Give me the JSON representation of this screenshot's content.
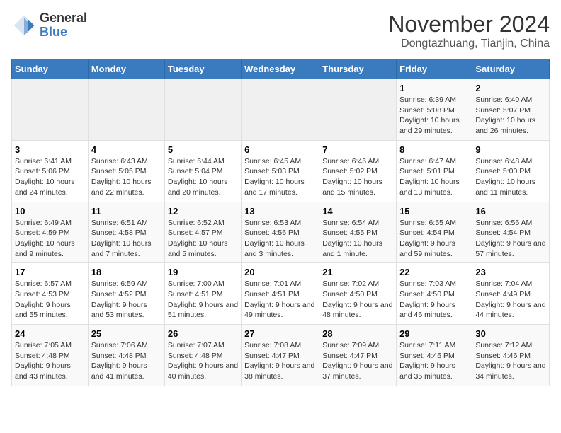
{
  "header": {
    "logo_general": "General",
    "logo_blue": "Blue",
    "month_title": "November 2024",
    "location": "Dongtazhuang, Tianjin, China"
  },
  "days_of_week": [
    "Sunday",
    "Monday",
    "Tuesday",
    "Wednesday",
    "Thursday",
    "Friday",
    "Saturday"
  ],
  "weeks": [
    [
      {
        "day": "",
        "info": ""
      },
      {
        "day": "",
        "info": ""
      },
      {
        "day": "",
        "info": ""
      },
      {
        "day": "",
        "info": ""
      },
      {
        "day": "",
        "info": ""
      },
      {
        "day": "1",
        "info": "Sunrise: 6:39 AM\nSunset: 5:08 PM\nDaylight: 10 hours and 29 minutes."
      },
      {
        "day": "2",
        "info": "Sunrise: 6:40 AM\nSunset: 5:07 PM\nDaylight: 10 hours and 26 minutes."
      }
    ],
    [
      {
        "day": "3",
        "info": "Sunrise: 6:41 AM\nSunset: 5:06 PM\nDaylight: 10 hours and 24 minutes."
      },
      {
        "day": "4",
        "info": "Sunrise: 6:43 AM\nSunset: 5:05 PM\nDaylight: 10 hours and 22 minutes."
      },
      {
        "day": "5",
        "info": "Sunrise: 6:44 AM\nSunset: 5:04 PM\nDaylight: 10 hours and 20 minutes."
      },
      {
        "day": "6",
        "info": "Sunrise: 6:45 AM\nSunset: 5:03 PM\nDaylight: 10 hours and 17 minutes."
      },
      {
        "day": "7",
        "info": "Sunrise: 6:46 AM\nSunset: 5:02 PM\nDaylight: 10 hours and 15 minutes."
      },
      {
        "day": "8",
        "info": "Sunrise: 6:47 AM\nSunset: 5:01 PM\nDaylight: 10 hours and 13 minutes."
      },
      {
        "day": "9",
        "info": "Sunrise: 6:48 AM\nSunset: 5:00 PM\nDaylight: 10 hours and 11 minutes."
      }
    ],
    [
      {
        "day": "10",
        "info": "Sunrise: 6:49 AM\nSunset: 4:59 PM\nDaylight: 10 hours and 9 minutes."
      },
      {
        "day": "11",
        "info": "Sunrise: 6:51 AM\nSunset: 4:58 PM\nDaylight: 10 hours and 7 minutes."
      },
      {
        "day": "12",
        "info": "Sunrise: 6:52 AM\nSunset: 4:57 PM\nDaylight: 10 hours and 5 minutes."
      },
      {
        "day": "13",
        "info": "Sunrise: 6:53 AM\nSunset: 4:56 PM\nDaylight: 10 hours and 3 minutes."
      },
      {
        "day": "14",
        "info": "Sunrise: 6:54 AM\nSunset: 4:55 PM\nDaylight: 10 hours and 1 minute."
      },
      {
        "day": "15",
        "info": "Sunrise: 6:55 AM\nSunset: 4:54 PM\nDaylight: 9 hours and 59 minutes."
      },
      {
        "day": "16",
        "info": "Sunrise: 6:56 AM\nSunset: 4:54 PM\nDaylight: 9 hours and 57 minutes."
      }
    ],
    [
      {
        "day": "17",
        "info": "Sunrise: 6:57 AM\nSunset: 4:53 PM\nDaylight: 9 hours and 55 minutes."
      },
      {
        "day": "18",
        "info": "Sunrise: 6:59 AM\nSunset: 4:52 PM\nDaylight: 9 hours and 53 minutes."
      },
      {
        "day": "19",
        "info": "Sunrise: 7:00 AM\nSunset: 4:51 PM\nDaylight: 9 hours and 51 minutes."
      },
      {
        "day": "20",
        "info": "Sunrise: 7:01 AM\nSunset: 4:51 PM\nDaylight: 9 hours and 49 minutes."
      },
      {
        "day": "21",
        "info": "Sunrise: 7:02 AM\nSunset: 4:50 PM\nDaylight: 9 hours and 48 minutes."
      },
      {
        "day": "22",
        "info": "Sunrise: 7:03 AM\nSunset: 4:50 PM\nDaylight: 9 hours and 46 minutes."
      },
      {
        "day": "23",
        "info": "Sunrise: 7:04 AM\nSunset: 4:49 PM\nDaylight: 9 hours and 44 minutes."
      }
    ],
    [
      {
        "day": "24",
        "info": "Sunrise: 7:05 AM\nSunset: 4:48 PM\nDaylight: 9 hours and 43 minutes."
      },
      {
        "day": "25",
        "info": "Sunrise: 7:06 AM\nSunset: 4:48 PM\nDaylight: 9 hours and 41 minutes."
      },
      {
        "day": "26",
        "info": "Sunrise: 7:07 AM\nSunset: 4:48 PM\nDaylight: 9 hours and 40 minutes."
      },
      {
        "day": "27",
        "info": "Sunrise: 7:08 AM\nSunset: 4:47 PM\nDaylight: 9 hours and 38 minutes."
      },
      {
        "day": "28",
        "info": "Sunrise: 7:09 AM\nSunset: 4:47 PM\nDaylight: 9 hours and 37 minutes."
      },
      {
        "day": "29",
        "info": "Sunrise: 7:11 AM\nSunset: 4:46 PM\nDaylight: 9 hours and 35 minutes."
      },
      {
        "day": "30",
        "info": "Sunrise: 7:12 AM\nSunset: 4:46 PM\nDaylight: 9 hours and 34 minutes."
      }
    ]
  ]
}
